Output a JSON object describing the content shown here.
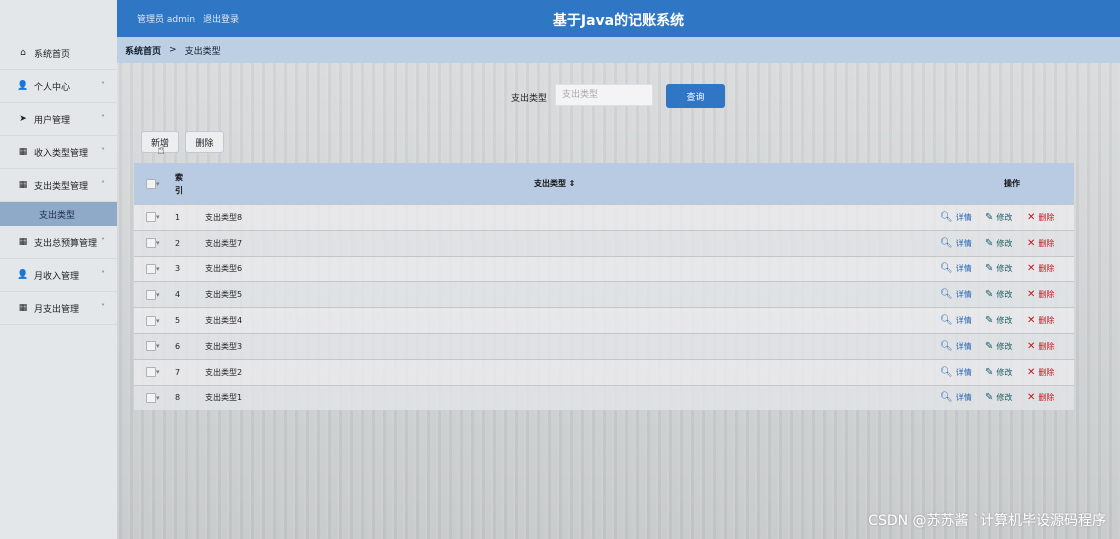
{
  "header": {
    "admin_label": "管理员 admin",
    "logout_label": "退出登录",
    "title": "基于Java的记账系统"
  },
  "sidebar": {
    "items": [
      {
        "label": "系统首页",
        "icon": "home-icon",
        "chev": ""
      },
      {
        "label": "个人中心",
        "icon": "user-icon",
        "chev": "˅"
      },
      {
        "label": "用户管理",
        "icon": "send-icon",
        "chev": "˅"
      },
      {
        "label": "收入类型管理",
        "icon": "grid-icon",
        "chev": "˅"
      },
      {
        "label": "支出类型管理",
        "icon": "grid-icon",
        "chev": "˄"
      },
      {
        "label": "支出总预算管理",
        "icon": "grid-icon",
        "chev": "˅"
      },
      {
        "label": "月收入管理",
        "icon": "user-icon",
        "chev": "˅"
      },
      {
        "label": "月支出管理",
        "icon": "grid-icon",
        "chev": "˅"
      }
    ],
    "active_sub": "支出类型"
  },
  "breadcrumb": {
    "home": "系统首页",
    "separator": ">",
    "current": "支出类型"
  },
  "search": {
    "label": "支出类型",
    "placeholder": "支出类型",
    "button": "查询"
  },
  "toolbar": {
    "add_label": "新增",
    "delete_label": "删除"
  },
  "table": {
    "headers": {
      "index": "索\n引",
      "type": "支出类型 ⇕",
      "ops": "操作"
    },
    "rows": [
      {
        "index": "1",
        "name": "支出类型8"
      },
      {
        "index": "2",
        "name": "支出类型7"
      },
      {
        "index": "3",
        "name": "支出类型6"
      },
      {
        "index": "4",
        "name": "支出类型5"
      },
      {
        "index": "5",
        "name": "支出类型4"
      },
      {
        "index": "6",
        "name": "支出类型3"
      },
      {
        "index": "7",
        "name": "支出类型2"
      },
      {
        "index": "8",
        "name": "支出类型1"
      }
    ],
    "actions": {
      "detail": "详情",
      "edit": "修改",
      "delete": "删除"
    }
  },
  "watermark": "CSDN @苏苏酱  ˋ计算机毕设源码程序"
}
